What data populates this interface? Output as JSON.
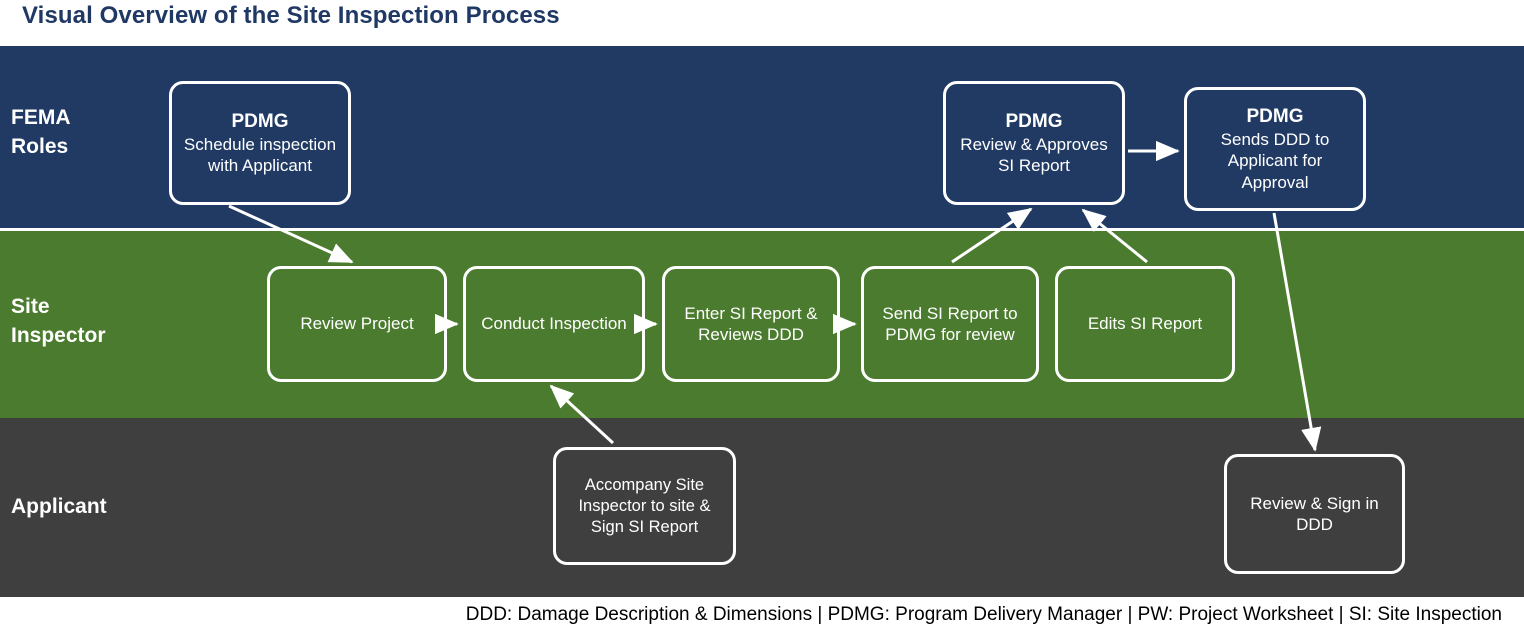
{
  "page": {
    "title": "Visual Overview of the Site Inspection Process"
  },
  "colors": {
    "title_text": "#1F3864",
    "fema_band": "#213A64",
    "site_inspector_band": "#4B7B2E",
    "applicant_band": "#3F3F3F",
    "node_border": "#FFFFFF",
    "node_text": "#FFFFFF",
    "arrow": "#FFFFFF",
    "footer_text": "#000000"
  },
  "lanes": [
    {
      "id": "fema",
      "label": "FEMA\nRoles",
      "nodes": [
        {
          "id": "pdmg-schedule",
          "header": "PDMG",
          "body": "Schedule inspection with Applicant"
        },
        {
          "id": "pdmg-review",
          "header": "PDMG",
          "body": "Review & Approves SI Report"
        },
        {
          "id": "pdmg-sends",
          "header": "PDMG",
          "body": "Sends DDD to Applicant for Approval"
        }
      ]
    },
    {
      "id": "site-inspector",
      "label": "Site\nInspector",
      "nodes": [
        {
          "id": "review-project",
          "header": "",
          "body": "Review Project"
        },
        {
          "id": "conduct",
          "header": "",
          "body": "Conduct Inspection"
        },
        {
          "id": "enter-si",
          "header": "",
          "body": "Enter SI Report & Reviews DDD"
        },
        {
          "id": "send-si",
          "header": "",
          "body": "Send SI Report to PDMG for review"
        },
        {
          "id": "edits-si",
          "header": "",
          "body": "Edits SI Report"
        }
      ]
    },
    {
      "id": "applicant",
      "label": "Applicant",
      "nodes": [
        {
          "id": "accompany",
          "header": "",
          "body": "Accompany Site Inspector to site & Sign SI Report"
        },
        {
          "id": "review-sign",
          "header": "",
          "body": "Review & Sign in DDD"
        }
      ]
    }
  ],
  "connectors": [
    {
      "id": "schedule-to-review-project",
      "from": "pdmg-schedule",
      "to": "review-project",
      "style": "diagonal-down-right"
    },
    {
      "id": "review-project-to-conduct",
      "from": "review-project",
      "to": "conduct",
      "style": "horizontal-right"
    },
    {
      "id": "conduct-to-enter-si",
      "from": "conduct",
      "to": "enter-si",
      "style": "horizontal-right"
    },
    {
      "id": "enter-si-to-send-si",
      "from": "enter-si",
      "to": "send-si",
      "style": "horizontal-right"
    },
    {
      "id": "accompany-to-conduct",
      "from": "accompany",
      "to": "conduct",
      "style": "diagonal-up-left"
    },
    {
      "id": "send-si-to-pdmg-review",
      "from": "send-si",
      "to": "pdmg-review",
      "style": "diagonal-up-right"
    },
    {
      "id": "edits-si-to-pdmg-review",
      "from": "edits-si",
      "to": "pdmg-review",
      "style": "diagonal-up-left"
    },
    {
      "id": "pdmg-review-to-pdmg-sends",
      "from": "pdmg-review",
      "to": "pdmg-sends",
      "style": "horizontal-right"
    },
    {
      "id": "pdmg-sends-to-review-sign",
      "from": "pdmg-sends",
      "to": "review-sign",
      "style": "diagonal-down-right"
    }
  ],
  "footer": {
    "legend": "DDD: Damage Description & Dimensions | PDMG: Program Delivery Manager | PW: Project Worksheet | SI: Site Inspection"
  }
}
